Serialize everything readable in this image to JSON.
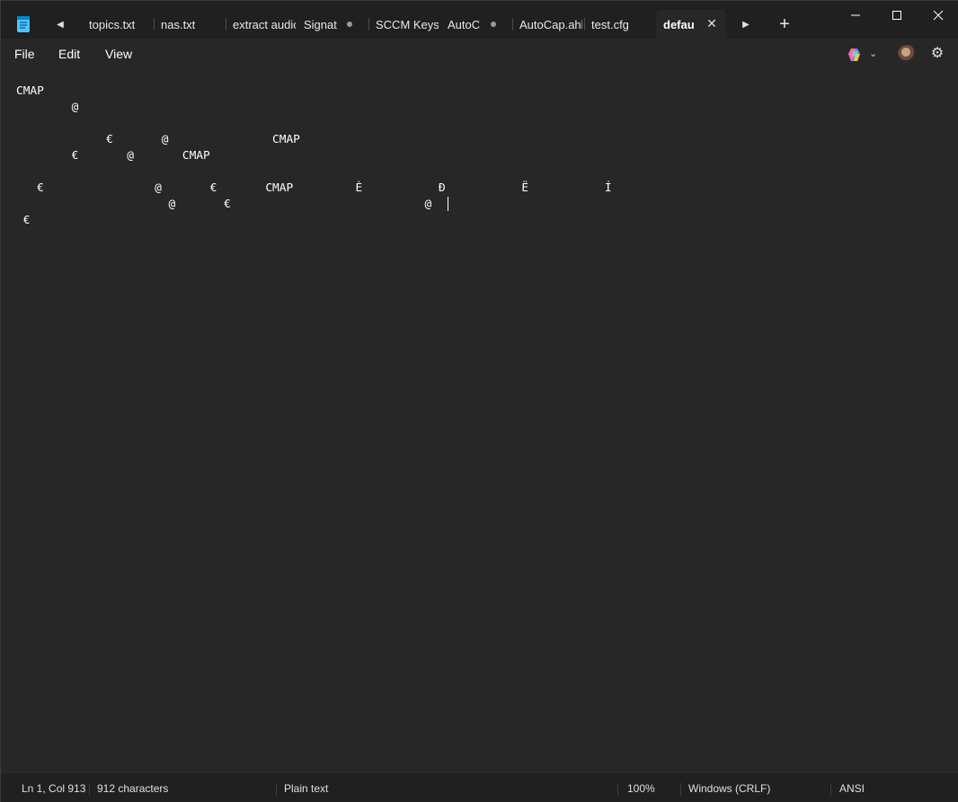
{
  "tabs": [
    {
      "label": "topics.txt",
      "modified": false,
      "active": false
    },
    {
      "label": "nas.txt",
      "modified": false,
      "active": false
    },
    {
      "label": "extract audio",
      "modified": false,
      "active": false
    },
    {
      "label": "Signat",
      "modified": true,
      "active": false
    },
    {
      "label": "SCCM Keys.t",
      "modified": false,
      "active": false
    },
    {
      "label": "AutoC",
      "modified": true,
      "active": false
    },
    {
      "label": "AutoCap.ahk",
      "modified": false,
      "active": false
    },
    {
      "label": "test.cfg",
      "modified": false,
      "active": false
    },
    {
      "label": "defau",
      "modified": false,
      "active": true
    }
  ],
  "tab_close_symbol": "✕",
  "new_tab_symbol": "+",
  "scroll_left_symbol": "◀",
  "scroll_right_symbol": "▶",
  "menu": {
    "file": "File",
    "edit": "Edit",
    "view": "View"
  },
  "icons": {
    "copilot_caret": "⌄",
    "gear": "⚙"
  },
  "editor": {
    "lines": [
      "CMAP  ",
      "        @       ",
      "                                         ",
      "             €       @               CMAP    ",
      "        €       @       CMAP                                    ",
      "                                                 ",
      "   €                @       €       CMAP         È           Ð           Ë           Í",
      "                      @       €                            @",
      " €                                        "
    ],
    "line_tops": [
      18,
      36,
      54,
      72,
      90,
      108,
      126,
      144
    ],
    "cursor_line": 8
  },
  "status": {
    "position": "Ln 1, Col 913",
    "characters": "912 characters",
    "format": "Plain text",
    "zoom": "100%",
    "line_ending": "Windows (CRLF)",
    "encoding": "ANSI"
  },
  "colors": {
    "background": "#272727",
    "tabbar": "#202020",
    "text": "#ffffff",
    "accent": "#ffffff"
  }
}
